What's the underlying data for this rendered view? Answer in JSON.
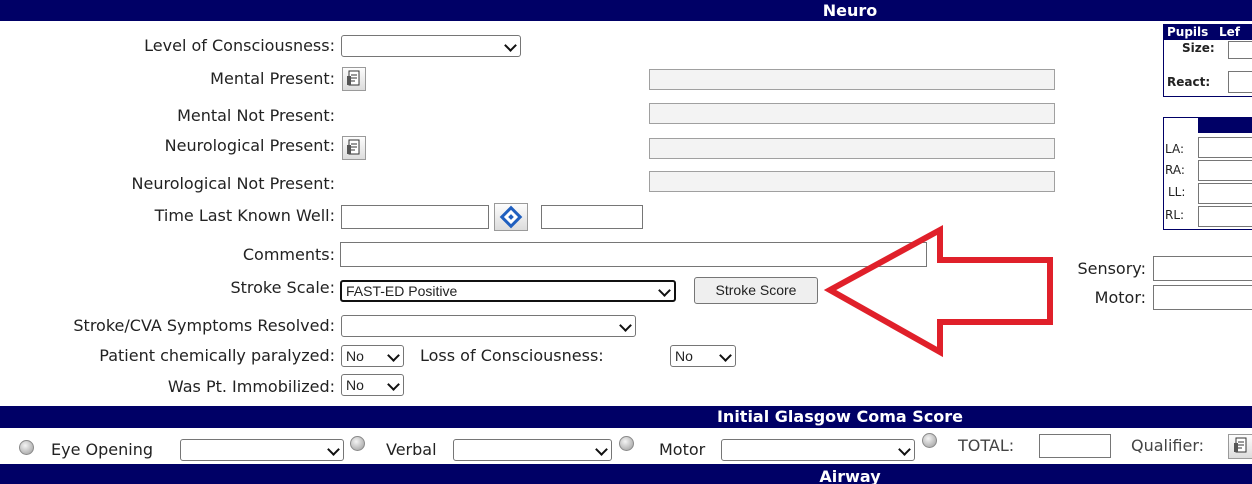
{
  "neuro": {
    "header": "Neuro",
    "level_of_consciousness": {
      "label": "Level of Consciousness:",
      "value": ""
    },
    "mental_present": {
      "label": "Mental Present:"
    },
    "mental_not_present": {
      "label": "Mental Not Present:"
    },
    "neurological_present": {
      "label": "Neurological Present:"
    },
    "neurological_not_present": {
      "label": "Neurological Not Present:"
    },
    "time_last_known_well": {
      "label": "Time Last Known Well:",
      "date": "",
      "time": ""
    },
    "comments": {
      "label": "Comments:",
      "value": ""
    },
    "stroke_scale": {
      "label": "Stroke Scale:",
      "value": "FAST-ED Positive",
      "button": "Stroke Score"
    },
    "stroke_resolved": {
      "label": "Stroke/CVA Symptoms Resolved:",
      "value": ""
    },
    "chemically_paralyzed": {
      "label": "Patient chemically paralyzed:",
      "value": "No"
    },
    "loss_of_consciousness": {
      "label": "Loss of Consciousness:",
      "value": "No"
    },
    "immobilized": {
      "label": "Was Pt. Immobilized:",
      "value": "No"
    }
  },
  "pupils": {
    "title": "Pupils",
    "col_left": "Lef",
    "size_label": "Size:",
    "react_label": "React:"
  },
  "limbs": {
    "la": "LA:",
    "ra": "RA:",
    "ll": "LL:",
    "rl": "RL:"
  },
  "side": {
    "sensory_label": "Sensory:",
    "motor_label": "Motor:"
  },
  "gcs": {
    "header": "Initial Glasgow Coma Score",
    "eye_label": "Eye Opening",
    "verbal_label": "Verbal",
    "motor_label": "Motor",
    "total_label": "TOTAL:",
    "qualifier_label": "Qualifier:"
  },
  "airway": {
    "header": "Airway"
  },
  "colors": {
    "header_bg": "#000066",
    "arrow": "#e0202a"
  }
}
